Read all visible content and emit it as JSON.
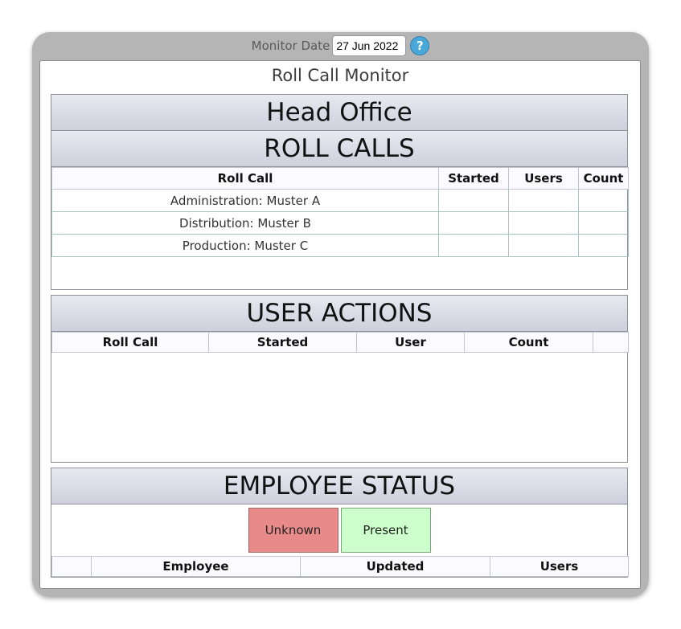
{
  "header": {
    "monitor_date_label": "Monitor Date",
    "monitor_date_value": "27 Jun 2022",
    "help_glyph": "?"
  },
  "page_title": "Roll Call Monitor",
  "office": {
    "name": "Head Office"
  },
  "roll_calls": {
    "heading": "ROLL CALLS",
    "columns": [
      "Roll Call",
      "Started",
      "Users",
      "Count"
    ],
    "rows": [
      {
        "roll_call": "Administration: Muster A",
        "started": "",
        "users": "",
        "count": ""
      },
      {
        "roll_call": "Distribution: Muster B",
        "started": "",
        "users": "",
        "count": ""
      },
      {
        "roll_call": "Production: Muster C",
        "started": "",
        "users": "",
        "count": ""
      }
    ]
  },
  "user_actions": {
    "heading": "USER ACTIONS",
    "columns": [
      "Roll Call",
      "Started",
      "User",
      "Count",
      ""
    ]
  },
  "employee_status": {
    "heading": "EMPLOYEE STATUS",
    "unknown_label": "Unknown",
    "present_label": "Present",
    "columns": [
      "",
      "Employee",
      "Updated",
      "Users"
    ]
  },
  "colors": {
    "unknown": "#e88a8a",
    "present": "#ccffcc",
    "help": "#4aa8d8"
  }
}
